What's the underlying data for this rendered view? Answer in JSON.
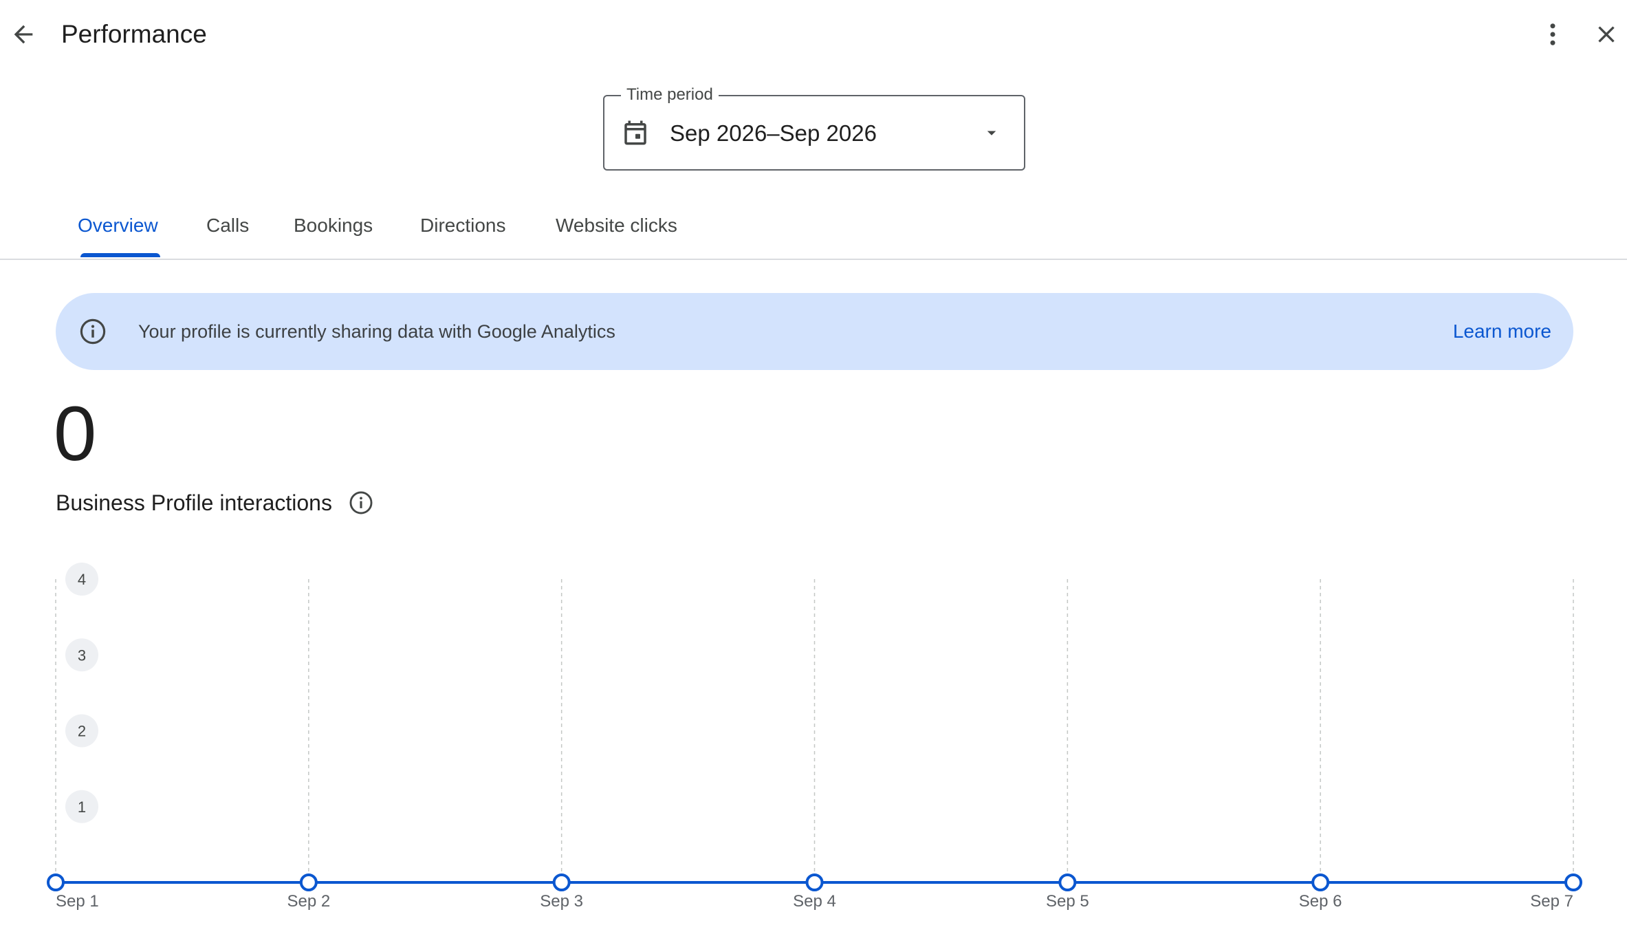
{
  "header": {
    "title": "Performance",
    "back_icon": "arrow-back-icon",
    "more_icon": "more-vert-icon",
    "close_icon": "close-icon"
  },
  "time_period": {
    "label": "Time period",
    "value": "Sep 2026–Sep 2026",
    "icon": "calendar-icon"
  },
  "tabs": [
    {
      "label": "Overview",
      "active": true
    },
    {
      "label": "Calls",
      "active": false
    },
    {
      "label": "Bookings",
      "active": false
    },
    {
      "label": "Directions",
      "active": false
    },
    {
      "label": "Website clicks",
      "active": false
    }
  ],
  "banner": {
    "text": "Your profile is currently sharing data with Google Analytics",
    "link": "Learn more",
    "icon": "info-icon"
  },
  "metric": {
    "value": "0",
    "label": "Business Profile interactions"
  },
  "colors": {
    "accent": "#0b57d0",
    "banner_bg": "#d3e3fd"
  },
  "chart_data": {
    "type": "line",
    "categories": [
      "Sep 1",
      "Sep 2",
      "Sep 3",
      "Sep 4",
      "Sep 5",
      "Sep 6",
      "Sep 7"
    ],
    "values": [
      0,
      0,
      0,
      0,
      0,
      0,
      0
    ],
    "yticks": [
      "1",
      "2",
      "3",
      "4"
    ],
    "ylim": [
      0,
      4
    ],
    "grid": "vertical-dashed",
    "color": "#0b57d0"
  }
}
